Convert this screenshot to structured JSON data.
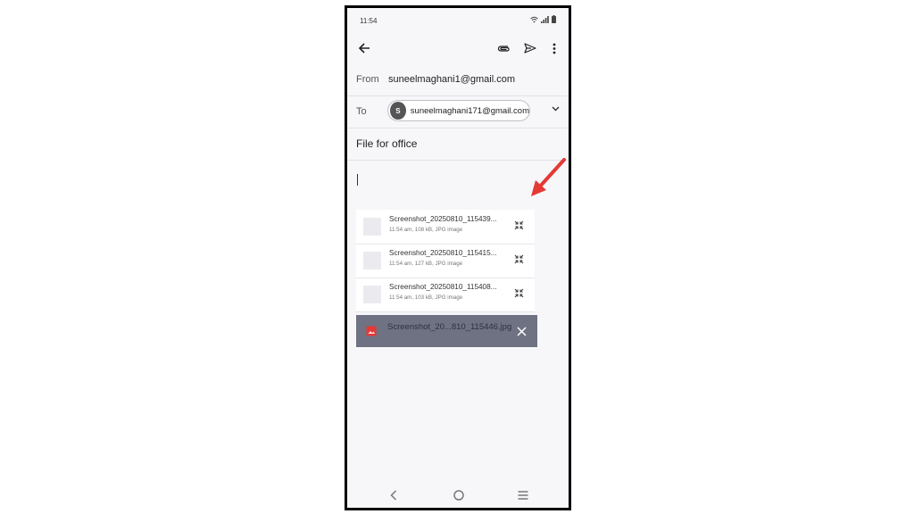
{
  "status_bar": {
    "time": "11:54"
  },
  "compose": {
    "from_label": "From",
    "from_value": "suneelmaghani1@gmail.com",
    "to_label": "To",
    "to_chip": {
      "avatar_letter": "S",
      "email": "suneelmaghani171@gmail.com"
    },
    "subject": "File for office"
  },
  "attachments": [
    {
      "name": "Screenshot_20250810_115439...",
      "meta": "11:54 am, 108 kB, JPG image"
    },
    {
      "name": "Screenshot_20250810_115415...",
      "meta": "11:54 am, 127 kB, JPG image"
    },
    {
      "name": "Screenshot_20250810_115408...",
      "meta": "11:54 am, 103 kB, JPG image"
    }
  ],
  "snackbar": {
    "filename": "Screenshot_20...810_115446.jpg"
  },
  "icons": {
    "back": "arrow-left-icon",
    "attach": "paperclip-icon",
    "send": "send-icon",
    "more": "more-vert-icon",
    "collapse": "collapse-arrows-icon",
    "close": "close-icon"
  },
  "colors": {
    "annotation_arrow": "#e53935",
    "snackbar_bg": "#6e7282",
    "file_icon": "#e53935"
  }
}
